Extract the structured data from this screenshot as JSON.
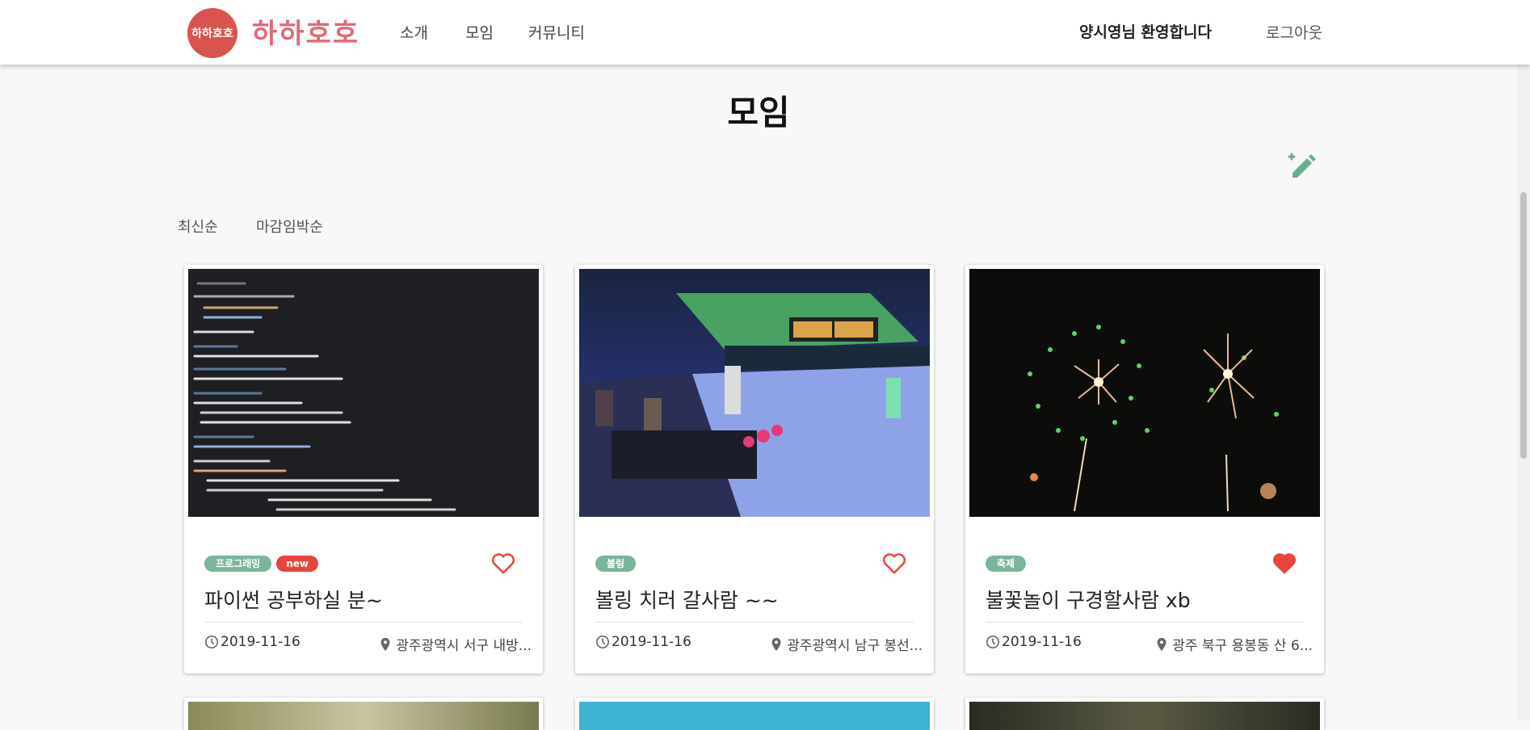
{
  "header": {
    "logo_badge": "하하호호",
    "logo_text": "하하호호",
    "nav": [
      "소개",
      "모임",
      "커뮤니티"
    ],
    "welcome": "양시영님 환영합니다",
    "logout": "로그아웃"
  },
  "page": {
    "title": "모임",
    "sort": [
      "최신순",
      "마감임박순"
    ]
  },
  "cards": [
    {
      "image": "code-screenshot",
      "tags": [
        "프로그래밍",
        "new"
      ],
      "liked": false,
      "title": "파이썬 공부하실 분~",
      "date": "2019-11-16",
      "location": "광주광역시 서구 내방..."
    },
    {
      "image": "bowling-alley",
      "tags": [
        "볼링"
      ],
      "liked": false,
      "title": "볼링 치러 갈사람 ~~",
      "date": "2019-11-16",
      "location": "광주광역시 남구 봉선..."
    },
    {
      "image": "fireworks",
      "tags": [
        "축제"
      ],
      "liked": true,
      "title": "불꽃놀이 구경할사람 xb",
      "date": "2019-11-16",
      "location": "광주 북구 용봉동 산 6..."
    }
  ],
  "colors": {
    "accent": "#e06a74",
    "tag": "#7bb59a",
    "new": "#e8453c",
    "heart": "#e8453c",
    "write_icon": "#6aae90"
  },
  "icons": {
    "write": "edit-add-icon",
    "heart": "heart-icon",
    "clock": "clock-icon",
    "location": "location-pin-icon"
  }
}
